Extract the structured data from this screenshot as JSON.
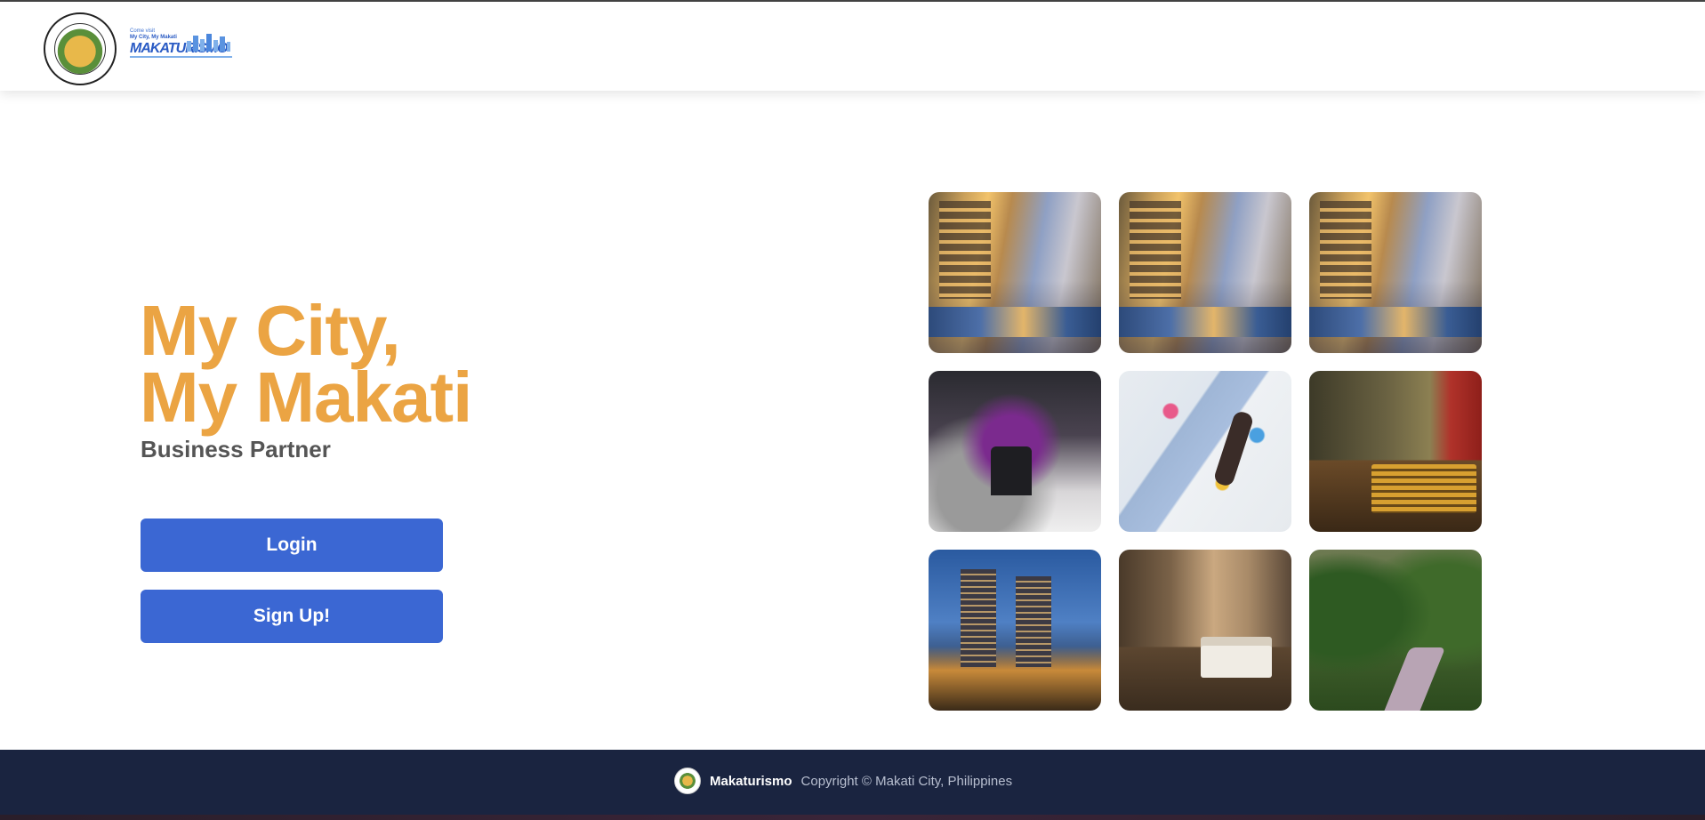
{
  "header": {
    "seal_alt": "Lungsod ng Makati seal",
    "seal_text_top": "LUNGSOD NG MAKATI",
    "seal_text_bottom": "PILIPINAS",
    "brand_tagline": "Come visit",
    "brand_slogan": "My City, My Makati",
    "brand_wordmark": "MAKATURISMO"
  },
  "hero": {
    "title_line1": "My City,",
    "title_line2": "My Makati",
    "subtitle": "Business Partner",
    "login_label": "Login",
    "signup_label": "Sign Up!"
  },
  "gallery": {
    "tiles": [
      {
        "subject": "night-mall"
      },
      {
        "subject": "night-mall"
      },
      {
        "subject": "night-mall"
      },
      {
        "subject": "graffiti-entrance"
      },
      {
        "subject": "climbing-wall"
      },
      {
        "subject": "lounge"
      },
      {
        "subject": "city-towers"
      },
      {
        "subject": "hotel-room"
      },
      {
        "subject": "garden-path"
      }
    ]
  },
  "footer": {
    "brand": "Makaturismo",
    "copyright": "Copyright © Makati City, Philippines"
  },
  "colors": {
    "accent_orange": "#eba443",
    "button_blue": "#3b67d3",
    "footer_navy": "#1a2440"
  }
}
